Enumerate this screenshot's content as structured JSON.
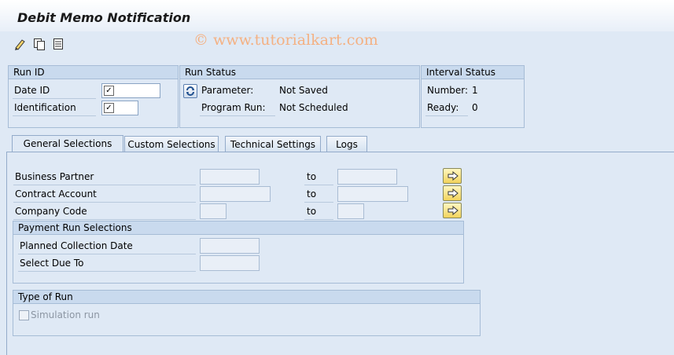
{
  "window": {
    "title": "Debit Memo Notification"
  },
  "watermark": "© www.tutorialkart.com",
  "toolbar": {
    "icons": [
      "execute-icon",
      "copy-icon",
      "details-icon"
    ]
  },
  "run_id": {
    "header": "Run ID",
    "date_id_label": "Date ID",
    "date_id_value": "",
    "identification_label": "Identification",
    "identification_value": ""
  },
  "run_status": {
    "header": "Run Status",
    "parameter_label": "Parameter:",
    "parameter_value": "Not Saved",
    "program_run_label": "Program Run:",
    "program_run_value": "Not Scheduled"
  },
  "interval_status": {
    "header": "Interval Status",
    "number_label": "Number:",
    "number_value": "1",
    "ready_label": "Ready:",
    "ready_value": "0"
  },
  "tabs": [
    "General Selections",
    "Custom Selections",
    "Technical Settings",
    "Logs"
  ],
  "selections": {
    "business_partner_label": "Business Partner",
    "contract_account_label": "Contract Account",
    "company_code_label": "Company Code",
    "to_label": "to"
  },
  "payment_run": {
    "header": "Payment Run Selections",
    "planned_collection_label": "Planned Collection Date",
    "select_due_label": "Select Due To"
  },
  "type_of_run": {
    "header": "Type of Run",
    "simulation_label": "Simulation run",
    "simulation_checked": false
  }
}
